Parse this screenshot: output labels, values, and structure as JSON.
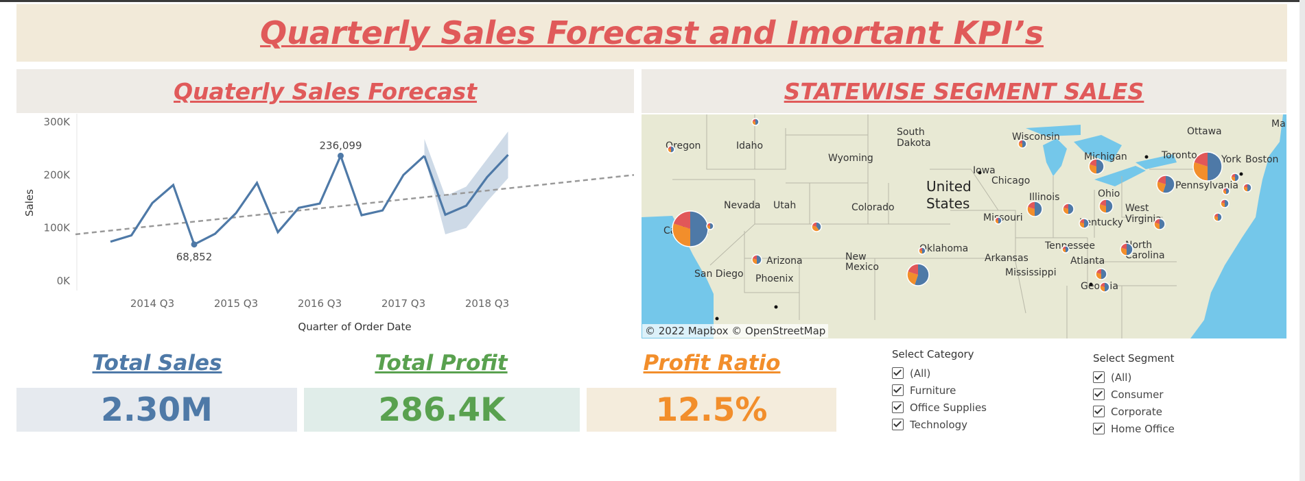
{
  "header": {
    "title": "Quarterly Sales Forecast and Imortant KPI’s"
  },
  "forecast_panel": {
    "title": "Quaterly Sales Forecast"
  },
  "map_panel": {
    "title": "STATEWISE SEGMENT SALES",
    "attribution": "© 2022 Mapbox  © OpenStreetMap"
  },
  "chart_data": {
    "type": "line",
    "ylabel": "Sales",
    "xlabel": "Quarter of Order Date",
    "y_ticks": [
      "300K",
      "200K",
      "100K",
      "0K"
    ],
    "x_ticks": [
      "2014 Q3",
      "2015 Q3",
      "2016 Q3",
      "2017 Q3",
      "2018 Q3"
    ],
    "ylim": [
      0,
      300000
    ],
    "series": [
      {
        "x": [
          "2014 Q1",
          "2014 Q2",
          "2014 Q3",
          "2014 Q4",
          "2015 Q1",
          "2015 Q2",
          "2015 Q3",
          "2015 Q4",
          "2016 Q1",
          "2016 Q2",
          "2016 Q3",
          "2016 Q4",
          "2017 Q1",
          "2017 Q2",
          "2017 Q3",
          "2017 Q4"
        ],
        "values": [
          74000,
          86000,
          147000,
          181000,
          68852,
          89000,
          128000,
          185000,
          92000,
          138000,
          146000,
          236099,
          124000,
          133000,
          200000,
          236000
        ]
      }
    ],
    "forecast": {
      "x": [
        "2017 Q4",
        "2018 Q1",
        "2018 Q2",
        "2018 Q3",
        "2018 Q4"
      ],
      "values": [
        236000,
        125000,
        142000,
        196000,
        238000
      ],
      "upper": [
        268000,
        160000,
        178000,
        230000,
        282000
      ],
      "lower": [
        236000,
        88000,
        100000,
        150000,
        194000
      ]
    },
    "trend": {
      "start": 88000,
      "end": 200000
    },
    "annotations": [
      {
        "x": "2016 Q4",
        "value": 236099,
        "label": "236,099"
      },
      {
        "x": "2015 Q1",
        "value": 68852,
        "label": "68,852"
      }
    ],
    "colors": {
      "line": "#4e79a7",
      "band": "#c5d3e3",
      "trend": "#999999"
    }
  },
  "map_labels": [
    "Oregon",
    "Idaho",
    "South Dakota",
    "Wisconsin",
    "Ottawa",
    "Maine",
    "Wyoming",
    "Michigan",
    "Toronto",
    "New York",
    "Boston",
    "Iowa",
    "Chicago",
    "United States",
    "Pennsylvania",
    "Nevada",
    "Utah",
    "Colorado",
    "Illinois",
    "Ohio",
    "West Virginia",
    "Missouri",
    "Kentucky",
    "Virginia",
    "Oklahoma",
    "Tennessee",
    "North Carolina",
    "Arizona",
    "New Mexico",
    "Arkansas",
    "Atlanta",
    "San Diego",
    "Phoenix",
    "Mississippi",
    "Georgia",
    "California"
  ],
  "map_text": {
    "oregon": "Oregon",
    "idaho": "Idaho",
    "south": "South",
    "dakota": "Dakota",
    "wisconsin": "Wisconsin",
    "ottawa": "Ottawa",
    "maine": "Maine",
    "wyoming": "Wyoming",
    "michigan": "Michigan",
    "toronto": "Toronto",
    "newyork": "New York",
    "boston": "Boston",
    "iowa": "Iowa",
    "chicago": "Chicago",
    "united": "United",
    "states": "States",
    "penn": "Pennsylvania",
    "nevada": "Nevada",
    "utah": "Utah",
    "colorado": "Colorado",
    "illinois": "Illinois",
    "ohio": "Ohio",
    "west": "West",
    "virginia": "Virginia",
    "missouri": "Missouri",
    "kentucky": "Kentucky",
    "oklahoma": "Oklahoma",
    "tennessee": "Tennessee",
    "north": "North",
    "carolina": "Carolina",
    "arizona": "Arizona",
    "new": "New",
    "mexico": "Mexico",
    "arkansas": "Arkansas",
    "atlanta": "Atlanta",
    "sandiego": "San Diego",
    "phoenix": "Phoenix",
    "mississippi": "Mississippi",
    "georgia": "Georgia",
    "california": "California"
  },
  "kpis": {
    "total_sales": {
      "title": "Total Sales",
      "value": "2.30M",
      "color": "#4e79a7",
      "bg": "#e6eaef"
    },
    "total_profit": {
      "title": "Total Profit",
      "value": "286.4K",
      "color": "#59a14f",
      "bg": "#e0ede9"
    },
    "profit_ratio": {
      "title": "Profit Ratio",
      "value": "12.5%",
      "color": "#f28e2b",
      "bg": "#f4ecdc"
    }
  },
  "filters": {
    "category": {
      "title": "Select Category",
      "options": [
        "(All)",
        "Furniture",
        "Office Supplies",
        "Technology"
      ]
    },
    "segment": {
      "title": "Select Segment",
      "options": [
        "(All)",
        "Consumer",
        "Corporate",
        "Home Office"
      ]
    }
  },
  "colors": {
    "accent": "#e05a5a",
    "segment_consumer": "#4e79a7",
    "segment_corporate": "#f28e2b",
    "segment_home": "#e15759"
  }
}
